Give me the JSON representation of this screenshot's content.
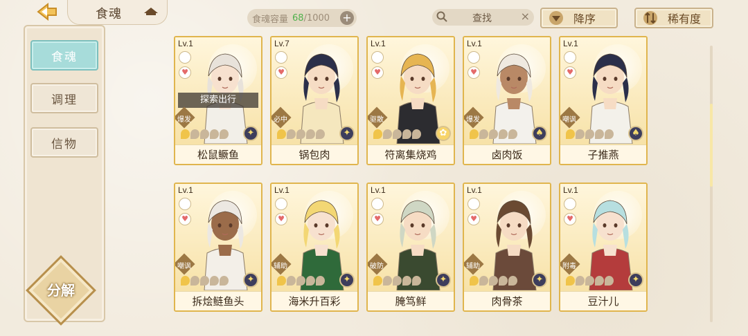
{
  "header": {
    "tab_title": "食魂",
    "capacity_label": "食魂容量",
    "capacity_current": "68",
    "capacity_max": "/1000",
    "capacity_add": "+",
    "search_placeholder": "查找",
    "search_clear": "×",
    "sort_order_label": "降序",
    "sort_by_label": "稀有度"
  },
  "sidebar": {
    "items": [
      {
        "label": "食魂",
        "active": true
      },
      {
        "label": "调理",
        "active": false
      },
      {
        "label": "信物",
        "active": false
      }
    ],
    "decompose_label": "分解"
  },
  "cards": [
    {
      "level": "Lv.1",
      "name": "松鼠鳜鱼",
      "role": "爆发",
      "stars": 1,
      "badge": "✦",
      "status": "探索出行",
      "hair": "#e8e2da",
      "outfit": "#f2efe8",
      "skin": "#f7e1cf"
    },
    {
      "level": "Lv.7",
      "name": "锅包肉",
      "role": "必中",
      "stars": 1,
      "badge": "✦",
      "status": "",
      "hair": "#2b2f4a",
      "outfit": "#f5e7be",
      "skin": "#f6dcc4"
    },
    {
      "level": "Lv.1",
      "name": "符离集烧鸡",
      "role": "驱散",
      "stars": 1,
      "badge": "✿",
      "status": "",
      "hair": "#e6b552",
      "outfit": "#2c2c30",
      "skin": "#f6dcc4"
    },
    {
      "level": "Lv.1",
      "name": "卤肉饭",
      "role": "爆发",
      "stars": 1,
      "badge": "♠",
      "status": "",
      "hair": "#efe9e0",
      "outfit": "#f3f1ec",
      "skin": "#b98966"
    },
    {
      "level": "Lv.1",
      "name": "子推燕",
      "role": "嘲讽",
      "stars": 1,
      "badge": "♠",
      "status": "",
      "hair": "#2b2f4a",
      "outfit": "#f3f1ea",
      "skin": "#f6dcc4"
    },
    {
      "level": "Lv.1",
      "name": "拆烩鲢鱼头",
      "role": "嘲讽",
      "stars": 1,
      "badge": "✦",
      "status": "",
      "hair": "#ece8e2",
      "outfit": "#f3efe8",
      "skin": "#9b6c4a"
    },
    {
      "level": "Lv.1",
      "name": "海米升百彩",
      "role": "辅助",
      "stars": 1,
      "badge": "✦",
      "status": "",
      "hair": "#f3d774",
      "outfit": "#2f6a3a",
      "skin": "#f7e1cf"
    },
    {
      "level": "Lv.1",
      "name": "腌笃鲜",
      "role": "破防",
      "stars": 1,
      "badge": "✦",
      "status": "",
      "hair": "#cfd7c4",
      "outfit": "#3a4a30",
      "skin": "#f6dcc4"
    },
    {
      "level": "Lv.1",
      "name": "肉骨茶",
      "role": "辅助",
      "stars": 1,
      "badge": "✦",
      "status": "",
      "hair": "#6a4a32",
      "outfit": "#6b4a3a",
      "skin": "#f6dcc4"
    },
    {
      "level": "Lv.1",
      "name": "豆汁儿",
      "role": "附毒",
      "stars": 1,
      "badge": "✦",
      "status": "",
      "hair": "#b7dfe0",
      "outfit": "#b43c3c",
      "skin": "#f7e1cf"
    }
  ],
  "colors": {
    "accent_teal": "#a7dcda",
    "card_border": "#e0b54d",
    "capacity_current": "#4fb04b"
  }
}
